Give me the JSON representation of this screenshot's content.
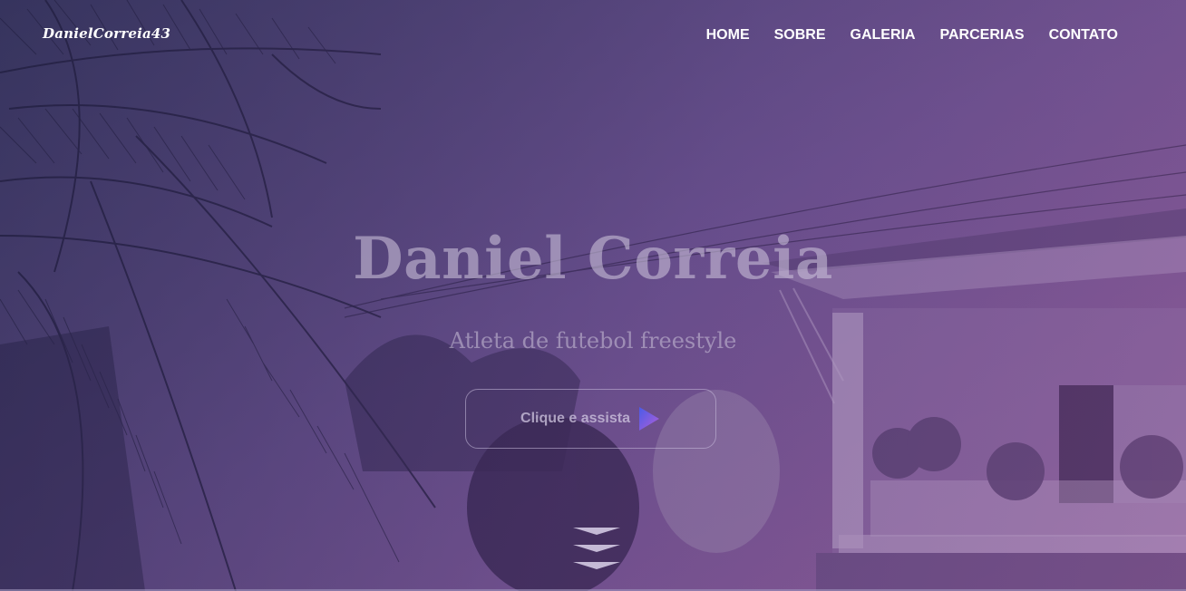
{
  "header": {
    "logo": "DanielCorreia43",
    "nav": [
      {
        "label": "HOME"
      },
      {
        "label": "SOBRE"
      },
      {
        "label": "GALERIA"
      },
      {
        "label": "PARCERIAS"
      },
      {
        "label": "CONTATO"
      }
    ]
  },
  "hero": {
    "title": "Daniel Correia",
    "subtitle": "Atleta de futebol freestyle",
    "watch_button_label": "Clique e assista",
    "play_icon": "play-icon",
    "scroll_icon": "chevrons-down-icon"
  },
  "colors": {
    "gradient_start": "#3b3a5e",
    "gradient_end": "#9b6aa0",
    "text": "#ffffff",
    "play_gradient_a": "#4a5be8",
    "play_gradient_b": "#b05fd8"
  }
}
